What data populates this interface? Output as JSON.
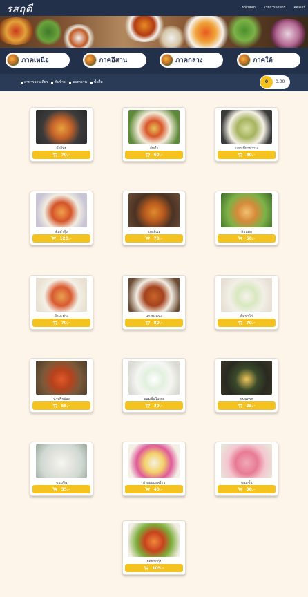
{
  "brand": {
    "name": "รสฤดี"
  },
  "nav": {
    "items": [
      "หน้าหลัก",
      "รายการอาหาร",
      "ออเดอร์"
    ]
  },
  "regions": [
    {
      "label": "ภาคเหนือ"
    },
    {
      "label": "ภาคอีสาน"
    },
    {
      "label": "ภาคกลาง"
    },
    {
      "label": "ภาคใต้"
    }
  ],
  "categories": [
    "อาหารจานเดียว",
    "กับข้าว",
    "ของหวาน",
    "น้ำดื่ม"
  ],
  "cart": {
    "count": "0",
    "total": "0.00"
  },
  "colors": {
    "navy": "#22304a",
    "accent": "#f5c320",
    "background": "#fdf5ea"
  },
  "menu": [
    {
      "name": "ผัดไทย",
      "price": "70.-"
    },
    {
      "name": "ส้มตำ",
      "price": "60.-"
    },
    {
      "name": "แกงเขียวหวาน",
      "price": "80.-"
    },
    {
      "name": "ต้มยำกุ้ง",
      "price": "120.-"
    },
    {
      "name": "แกงฮังเล",
      "price": "70.-"
    },
    {
      "name": "ห่อหมก",
      "price": "50.-"
    },
    {
      "name": "ยำมะม่วง",
      "price": "70.-"
    },
    {
      "name": "แกงพะแนง",
      "price": "80.-"
    },
    {
      "name": "ต้มข่าไก่",
      "price": "70.-"
    },
    {
      "name": "น้ำพริกอ่อง",
      "price": "55.-"
    },
    {
      "name": "ขนมชั้นใบเตย",
      "price": "30.-"
    },
    {
      "name": "ขนมครก",
      "price": "25.-"
    },
    {
      "name": "ขนมจีน",
      "price": "35.-"
    },
    {
      "name": "บัวลอยมะพร้าว",
      "price": "40.-"
    },
    {
      "name": "ขนมชั้น",
      "price": "38.-"
    },
    {
      "name": "ผัดพริกกุ้ง",
      "price": "105.-"
    }
  ]
}
